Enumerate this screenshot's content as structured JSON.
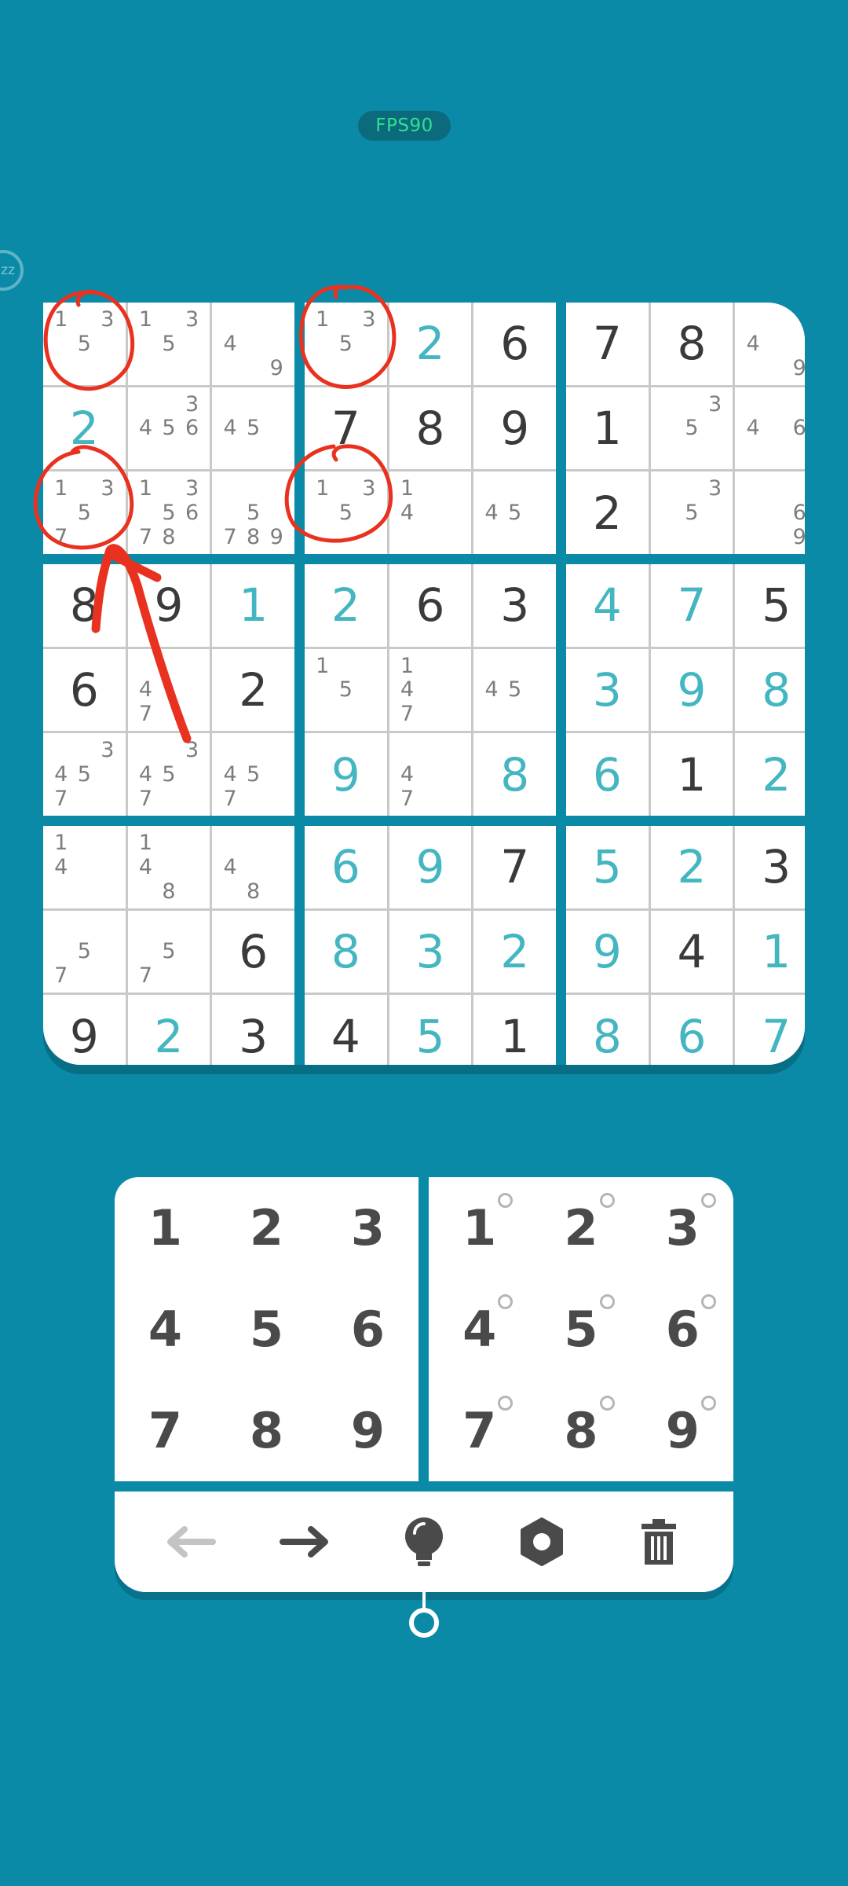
{
  "status": {
    "fps_label": "FPS90",
    "sleep_icon_label": "zz"
  },
  "board": {
    "rows": [
      [
        {
          "notes": [
            "1",
            "",
            "3",
            "",
            "5",
            "",
            "",
            "",
            ""
          ]
        },
        {
          "notes": [
            "1",
            "",
            "3",
            "",
            "5",
            "",
            "",
            "",
            ""
          ]
        },
        {
          "notes": [
            "",
            "",
            "",
            "4",
            "",
            "",
            "",
            "",
            "9"
          ]
        },
        {
          "notes": [
            "1",
            "",
            "3",
            "",
            "5",
            "",
            "",
            "",
            ""
          ]
        },
        {
          "value": "2",
          "type": "user"
        },
        {
          "value": "6",
          "type": "given"
        },
        {
          "value": "7",
          "type": "given"
        },
        {
          "value": "8",
          "type": "given"
        },
        {
          "notes": [
            "",
            "",
            "",
            "4",
            "",
            "",
            "",
            "",
            "9"
          ]
        }
      ],
      [
        {
          "value": "2",
          "type": "user"
        },
        {
          "notes": [
            "",
            "",
            "3",
            "4",
            "5",
            "6",
            "",
            "",
            ""
          ]
        },
        {
          "notes": [
            "",
            "",
            "",
            "4",
            "5",
            "",
            "",
            "",
            ""
          ]
        },
        {
          "value": "7",
          "type": "given"
        },
        {
          "value": "8",
          "type": "given"
        },
        {
          "value": "9",
          "type": "given"
        },
        {
          "value": "1",
          "type": "given"
        },
        {
          "notes": [
            "",
            "",
            "3",
            "",
            "5",
            "",
            "",
            "",
            ""
          ]
        },
        {
          "notes": [
            "",
            "",
            "",
            "4",
            "",
            "6",
            "",
            "",
            ""
          ]
        }
      ],
      [
        {
          "notes": [
            "1",
            "",
            "3",
            "",
            "5",
            "",
            "7",
            "",
            ""
          ]
        },
        {
          "notes": [
            "1",
            "",
            "3",
            "",
            "5",
            "6",
            "7",
            "8",
            ""
          ]
        },
        {
          "notes": [
            "",
            "",
            "",
            "",
            "5",
            "",
            "7",
            "8",
            "9"
          ]
        },
        {
          "notes": [
            "1",
            "",
            "3",
            "",
            "5",
            "",
            "",
            "",
            ""
          ]
        },
        {
          "notes": [
            "1",
            "",
            "",
            "4",
            "",
            "",
            "",
            "",
            ""
          ]
        },
        {
          "notes": [
            "",
            "",
            "",
            "4",
            "5",
            "",
            "",
            "",
            ""
          ]
        },
        {
          "value": "2",
          "type": "given"
        },
        {
          "notes": [
            "",
            "",
            "3",
            "",
            "5",
            "",
            "",
            "",
            ""
          ]
        },
        {
          "notes": [
            "",
            "",
            "",
            "",
            "",
            "6",
            "",
            "",
            "9"
          ]
        }
      ],
      [
        {
          "value": "8",
          "type": "given"
        },
        {
          "value": "9",
          "type": "given"
        },
        {
          "value": "1",
          "type": "user"
        },
        {
          "value": "2",
          "type": "user"
        },
        {
          "value": "6",
          "type": "given"
        },
        {
          "value": "3",
          "type": "given"
        },
        {
          "value": "4",
          "type": "user"
        },
        {
          "value": "7",
          "type": "user"
        },
        {
          "value": "5",
          "type": "given"
        }
      ],
      [
        {
          "value": "6",
          "type": "given"
        },
        {
          "notes": [
            "",
            "",
            "",
            "4",
            "",
            "",
            "7",
            "",
            ""
          ]
        },
        {
          "value": "2",
          "type": "given"
        },
        {
          "notes": [
            "1",
            "",
            "",
            "",
            "5",
            "",
            "",
            "",
            ""
          ]
        },
        {
          "notes": [
            "1",
            "",
            "",
            "4",
            "",
            "",
            "7",
            "",
            ""
          ]
        },
        {
          "notes": [
            "",
            "",
            "",
            "4",
            "5",
            "",
            "",
            "",
            ""
          ]
        },
        {
          "value": "3",
          "type": "user"
        },
        {
          "value": "9",
          "type": "user"
        },
        {
          "value": "8",
          "type": "user"
        }
      ],
      [
        {
          "notes": [
            "",
            "",
            "3",
            "4",
            "5",
            "",
            "7",
            "",
            ""
          ]
        },
        {
          "notes": [
            "",
            "",
            "3",
            "4",
            "5",
            "",
            "7",
            "",
            ""
          ]
        },
        {
          "notes": [
            "",
            "",
            "",
            "4",
            "5",
            "",
            "7",
            "",
            ""
          ]
        },
        {
          "value": "9",
          "type": "user"
        },
        {
          "notes": [
            "",
            "",
            "",
            "4",
            "",
            "",
            "7",
            "",
            ""
          ]
        },
        {
          "value": "8",
          "type": "user"
        },
        {
          "value": "6",
          "type": "user"
        },
        {
          "value": "1",
          "type": "given"
        },
        {
          "value": "2",
          "type": "user"
        }
      ],
      [
        {
          "notes": [
            "1",
            "",
            "",
            "4",
            "",
            "",
            "",
            "",
            ""
          ]
        },
        {
          "notes": [
            "1",
            "",
            "",
            "4",
            "",
            "",
            "",
            "8",
            ""
          ]
        },
        {
          "notes": [
            "",
            "",
            "",
            "4",
            "",
            "",
            "",
            "8",
            ""
          ]
        },
        {
          "value": "6",
          "type": "user"
        },
        {
          "value": "9",
          "type": "user"
        },
        {
          "value": "7",
          "type": "given"
        },
        {
          "value": "5",
          "type": "user"
        },
        {
          "value": "2",
          "type": "user"
        },
        {
          "value": "3",
          "type": "given"
        }
      ],
      [
        {
          "notes": [
            "",
            "",
            "",
            "",
            "5",
            "",
            "7",
            "",
            ""
          ]
        },
        {
          "notes": [
            "",
            "",
            "",
            "",
            "5",
            "",
            "7",
            "",
            ""
          ]
        },
        {
          "value": "6",
          "type": "given"
        },
        {
          "value": "8",
          "type": "user"
        },
        {
          "value": "3",
          "type": "user"
        },
        {
          "value": "2",
          "type": "user"
        },
        {
          "value": "9",
          "type": "user"
        },
        {
          "value": "4",
          "type": "given"
        },
        {
          "value": "1",
          "type": "user"
        }
      ],
      [
        {
          "value": "9",
          "type": "given"
        },
        {
          "value": "2",
          "type": "user"
        },
        {
          "value": "3",
          "type": "given"
        },
        {
          "value": "4",
          "type": "given"
        },
        {
          "value": "5",
          "type": "user"
        },
        {
          "value": "1",
          "type": "given"
        },
        {
          "value": "8",
          "type": "user"
        },
        {
          "value": "6",
          "type": "user"
        },
        {
          "value": "7",
          "type": "user"
        }
      ]
    ]
  },
  "number_pad": {
    "digits": [
      "1",
      "2",
      "3",
      "4",
      "5",
      "6",
      "7",
      "8",
      "9"
    ]
  },
  "notes_pad": {
    "digits": [
      "1",
      "2",
      "3",
      "4",
      "5",
      "6",
      "7",
      "8",
      "9"
    ]
  },
  "toolbar": {
    "tools": [
      {
        "icon": "undo-arrow-icon",
        "enabled": false
      },
      {
        "icon": "redo-arrow-icon",
        "enabled": true
      },
      {
        "icon": "hint-bulb-icon",
        "enabled": true
      },
      {
        "icon": "settings-gear-icon",
        "enabled": true
      },
      {
        "icon": "trash-icon",
        "enabled": true
      }
    ]
  },
  "colors": {
    "background": "#0a8aa7",
    "given_digit": "#3a3a3a",
    "user_digit": "#43b6c1",
    "note_digit": "#7d7d7d",
    "annotation": "#e8321f"
  }
}
